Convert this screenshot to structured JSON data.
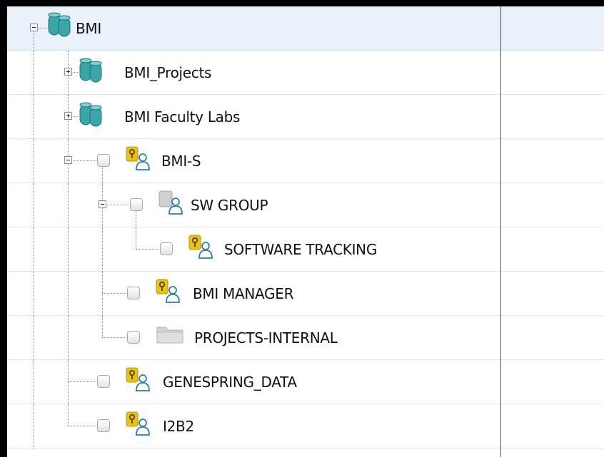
{
  "tree": {
    "rows": [
      {
        "label": "BMI",
        "icon": "database-icon",
        "expander": "minus",
        "checkbox": false,
        "selected": true
      },
      {
        "label": "BMI_Projects",
        "icon": "database-icon",
        "expander": "plus",
        "checkbox": false
      },
      {
        "label": "BMI Faculty Labs",
        "icon": "database-icon",
        "expander": "plus",
        "checkbox": false
      },
      {
        "label": "BMI-S",
        "icon": "secure-group-icon",
        "expander": "minus",
        "checkbox": true
      },
      {
        "label": "SW GROUP",
        "icon": "group-folder-icon",
        "expander": "minus",
        "checkbox": true
      },
      {
        "label": "SOFTWARE TRACKING",
        "icon": "secure-group-icon",
        "expander": "none",
        "checkbox": true
      },
      {
        "label": "BMI MANAGER",
        "icon": "secure-group-icon",
        "expander": "none",
        "checkbox": true
      },
      {
        "label": "PROJECTS-INTERNAL",
        "icon": "folder-icon",
        "expander": "none",
        "checkbox": true
      },
      {
        "label": "GENESPRING_DATA",
        "icon": "secure-group-icon",
        "expander": "none",
        "checkbox": true
      },
      {
        "label": "I2B2",
        "icon": "secure-group-icon",
        "expander": "none",
        "checkbox": true
      }
    ]
  },
  "colors": {
    "selected_row": "#eaf1fb",
    "divider": "#3c4d78",
    "database": "#3aa6a8",
    "key_badge": "#e8c21a",
    "person": "#2f7fa6",
    "folder": "#cfcfcf"
  }
}
